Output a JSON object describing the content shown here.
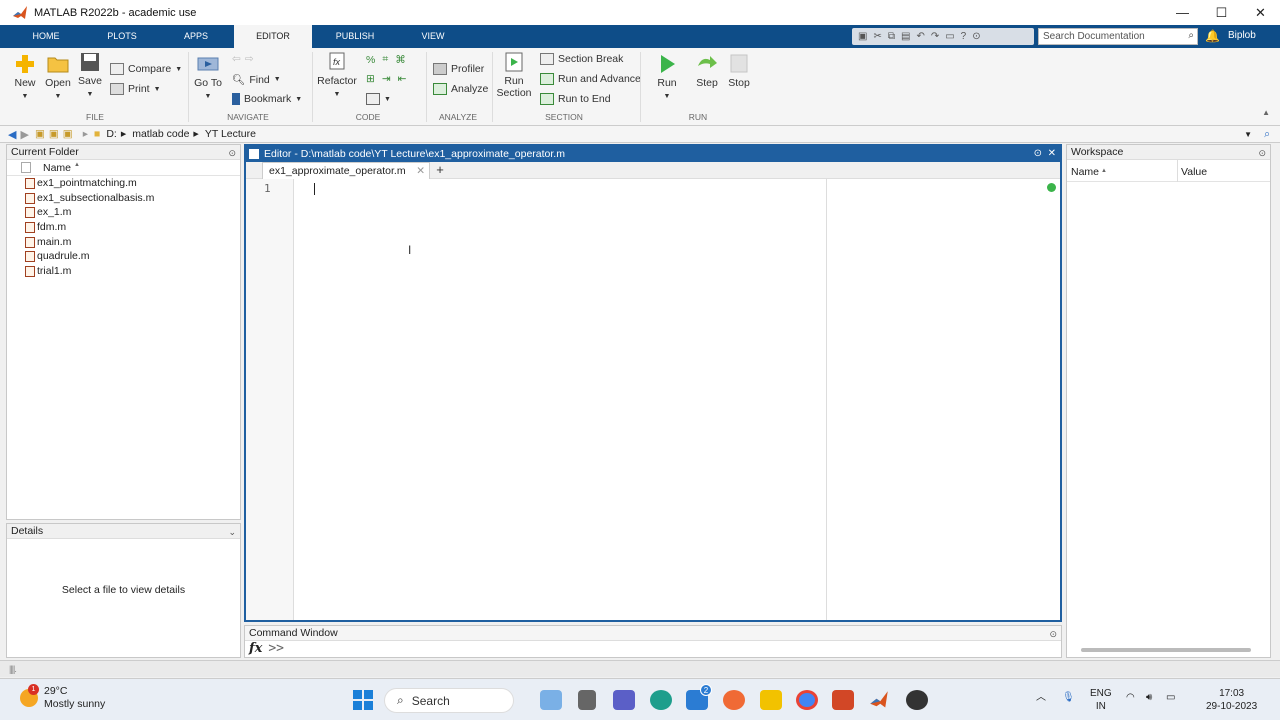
{
  "window": {
    "title": "MATLAB R2022b - academic use",
    "minimize": "—",
    "maximize": "☐",
    "close": "✕"
  },
  "tabs": [
    "HOME",
    "PLOTS",
    "APPS",
    "EDITOR",
    "PUBLISH",
    "VIEW"
  ],
  "search": {
    "placeholder": "Search Documentation"
  },
  "user": "Biplob",
  "ribbon": {
    "file": {
      "new": "New",
      "open": "Open",
      "save": "Save",
      "compare": "Compare",
      "print": "Print",
      "label": "FILE"
    },
    "navigate": {
      "goto": "Go To",
      "find": "Find",
      "bookmark": "Bookmark",
      "label": "NAVIGATE"
    },
    "code": {
      "refactor": "Refactor",
      "label": "CODE"
    },
    "analyze": {
      "profiler": "Profiler",
      "analyze": "Analyze",
      "label": "ANALYZE"
    },
    "section": {
      "run_section": "Run Section",
      "section_break": "Section Break",
      "run_advance": "Run and Advance",
      "run_end": "Run to End",
      "label": "SECTION"
    },
    "run": {
      "run": "Run",
      "step": "Step",
      "stop": "Stop",
      "label": "RUN"
    }
  },
  "address": {
    "drive": "D:",
    "folder1": "matlab code",
    "folder2": "YT Lecture"
  },
  "current_folder": {
    "title": "Current Folder",
    "name_col": "Name",
    "files": [
      "ex1_pointmatching.m",
      "ex1_subsectionalbasis.m",
      "ex_1.m",
      "fdm.m",
      "main.m",
      "quadrule.m",
      "trial1.m"
    ]
  },
  "details": {
    "title": "Details",
    "message": "Select a file to view details"
  },
  "editor": {
    "title": "Editor - D:\\matlab code\\YT Lecture\\ex1_approximate_operator.m",
    "tab": "ex1_approximate_operator.m",
    "line_number": "1"
  },
  "command_window": {
    "title": "Command Window",
    "fx": "fx",
    "prompt": ">>"
  },
  "workspace": {
    "title": "Workspace",
    "name_col": "Name",
    "value_col": "Value"
  },
  "taskbar": {
    "weather_temp": "29°C",
    "weather_desc": "Mostly sunny",
    "weather_badge": "1",
    "search": "Search",
    "lang1": "ENG",
    "lang2": "IN",
    "time": "17:03",
    "date": "29-10-2023",
    "teams_badge": "2"
  },
  "colors": {
    "tab_bar": "#0e4d88",
    "editor_border": "#1f5fa0",
    "accent_green": "#3bb44a"
  }
}
